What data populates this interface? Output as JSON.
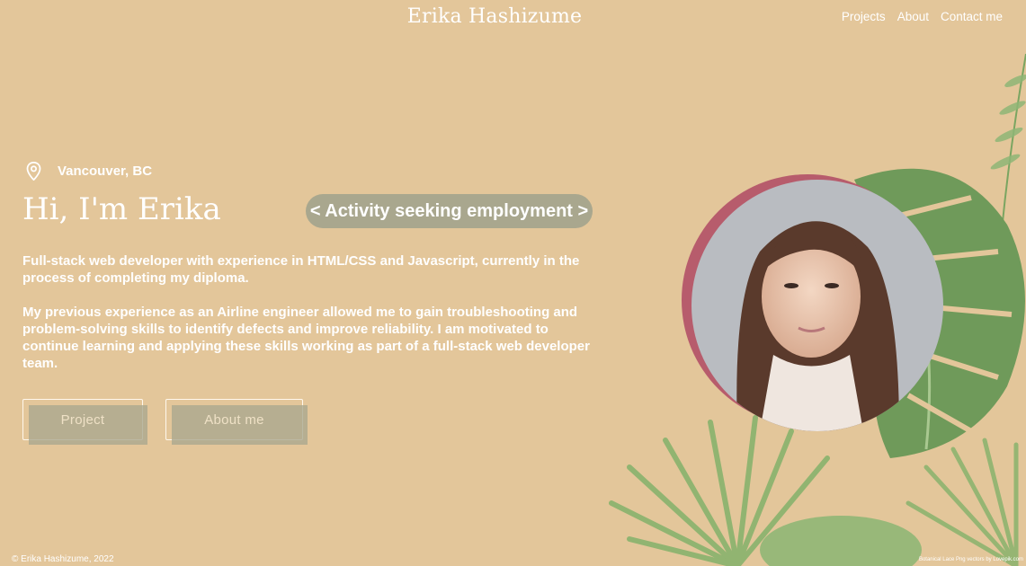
{
  "header": {
    "site_title": "Erika Hashizume",
    "nav": [
      "Projects",
      "About",
      "Contact me"
    ]
  },
  "hero": {
    "location": "Vancouver, BC",
    "location_icon": "map-pin-icon",
    "greeting": "Hi, I'm Erika",
    "status": "< Activity seeking employment >",
    "intro_1": "Full-stack web developer with experience in HTML/CSS and Javascript, currently in the process of completing my diploma.",
    "intro_2": "My previous experience as an Airline engineer allowed me to gain troubleshooting and problem-solving skills to identify defects and improve reliability. I am motivated to continue learning and applying these skills working as part of a full-stack web developer team.",
    "buttons": {
      "project": "Project",
      "about": "About me"
    }
  },
  "footer": {
    "copyright": "© Erika Hashizume, 2022",
    "credit": "Botanical Lace Png vectors by Lovepik.com"
  },
  "colors": {
    "background": "#e3c69a",
    "accent_pill": "#a9a78e",
    "portrait_ring": "#b75c6c",
    "leaf_green": "#6f9a5a"
  }
}
